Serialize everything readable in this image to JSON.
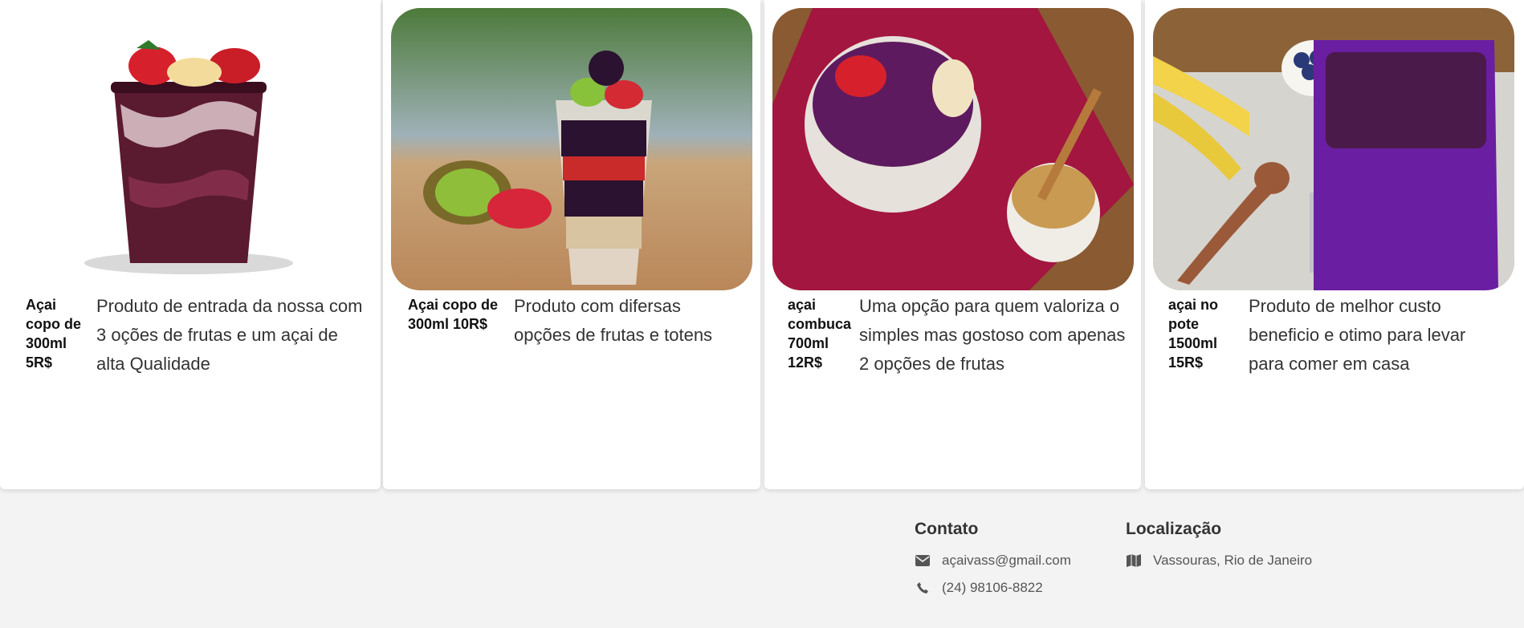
{
  "products": [
    {
      "title": "Açai copo de 300ml 5R$",
      "description": "Produto de entrada da nossa com 3 oções de frutas e um açai de alta Qualidade",
      "image": "acai-cup-strawberry-banana"
    },
    {
      "title": "Açai copo de 300ml 10R$",
      "description": "Produto com difersas opções de frutas e totens",
      "image": "acai-parfait-cup-kiwi"
    },
    {
      "title": "açai combuca 700ml 12R$",
      "description": "Uma opção para quem valoriza o simples mas gostoso com apenas 2 opções de frutas",
      "image": "acai-bowl-granola"
    },
    {
      "title": "açai no pote 1500ml 15R$",
      "description": "Produto de melhor custo beneficio e otimo para levar para comer em casa",
      "image": "acai-tub-bananas"
    }
  ],
  "footer": {
    "contact": {
      "heading": "Contato",
      "email": "açaivass@gmail.com",
      "phone": "(24) 98106-8822"
    },
    "location": {
      "heading": "Localização",
      "address": "Vassouras, Rio de Janeiro"
    }
  },
  "icons": {
    "email": "envelope-icon",
    "phone": "phone-icon",
    "location": "map-icon"
  },
  "colors": {
    "background": "#f3f3f3",
    "card": "#ffffff",
    "acai": "#4a1030"
  }
}
